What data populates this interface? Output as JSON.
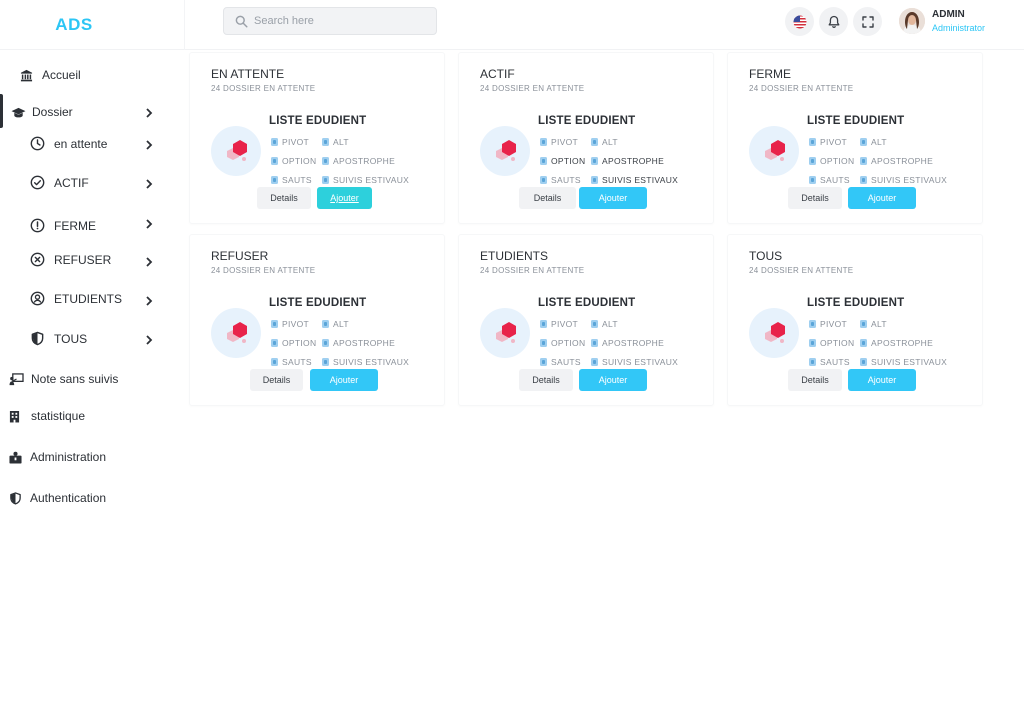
{
  "app": {
    "brand": "ADS"
  },
  "search": {
    "placeholder": "Search here"
  },
  "header": {
    "icons": [
      "us-flag-icon",
      "bell-icon",
      "fullscreen-icon"
    ],
    "user": {
      "name": "ADMIN",
      "role": "Administrator"
    }
  },
  "sidebar": {
    "items": [
      {
        "label": "Accueil",
        "icon": "bank-icon"
      },
      {
        "label": "Dossier",
        "icon": "graduation-cap-icon"
      },
      {
        "label": "Note sans suivis",
        "icon": "presentation-icon"
      },
      {
        "label": "statistique",
        "icon": "building-icon"
      },
      {
        "label": "Administration",
        "icon": "briefcase-user-icon"
      },
      {
        "label": "Authentication",
        "icon": "shield-icon"
      }
    ],
    "dossier_sub": [
      {
        "label": "en attente",
        "icon": "clock-icon"
      },
      {
        "label": "ACTIF",
        "icon": "check-circle-icon"
      },
      {
        "label": "FERME",
        "icon": "exclamation-circle-icon"
      },
      {
        "label": "REFUSER",
        "icon": "x-circle-icon"
      },
      {
        "label": "ETUDIENTS",
        "icon": "user-circle-icon"
      },
      {
        "label": "TOUS",
        "icon": "shield-half-icon"
      }
    ]
  },
  "cards": [
    {
      "title": "EN ATTENTE",
      "subtitle": "24 DOSSIER EN ATTENTE"
    },
    {
      "title": "ACTIF",
      "subtitle": "24 DOSSIER EN ATTENTE"
    },
    {
      "title": "FERME",
      "subtitle": "24 DOSSIER EN ATTENTE"
    },
    {
      "title": "REFUSER",
      "subtitle": "24 DOSSIER EN ATTENTE"
    },
    {
      "title": "ETUDIENTS",
      "subtitle": "24 DOSSIER EN ATTENTE"
    },
    {
      "title": "TOUS",
      "subtitle": "24 DOSSIER EN ATTENTE"
    }
  ],
  "card_common": {
    "heading": "LISTE EDUDIENT",
    "tags": {
      "pivot": "PIVOT",
      "alt": "ALT",
      "option": "OPTION",
      "apostrophe": "APOSTROPHE",
      "sauts": "SAUTS",
      "suivis": "SUIVIS ESTIVAUX"
    },
    "details_label": "Details",
    "add_label": "Ajouter"
  },
  "colors": {
    "accent": "#2cc6f5",
    "button_add": "#32c7f7",
    "logo_red": "#e8234a"
  }
}
